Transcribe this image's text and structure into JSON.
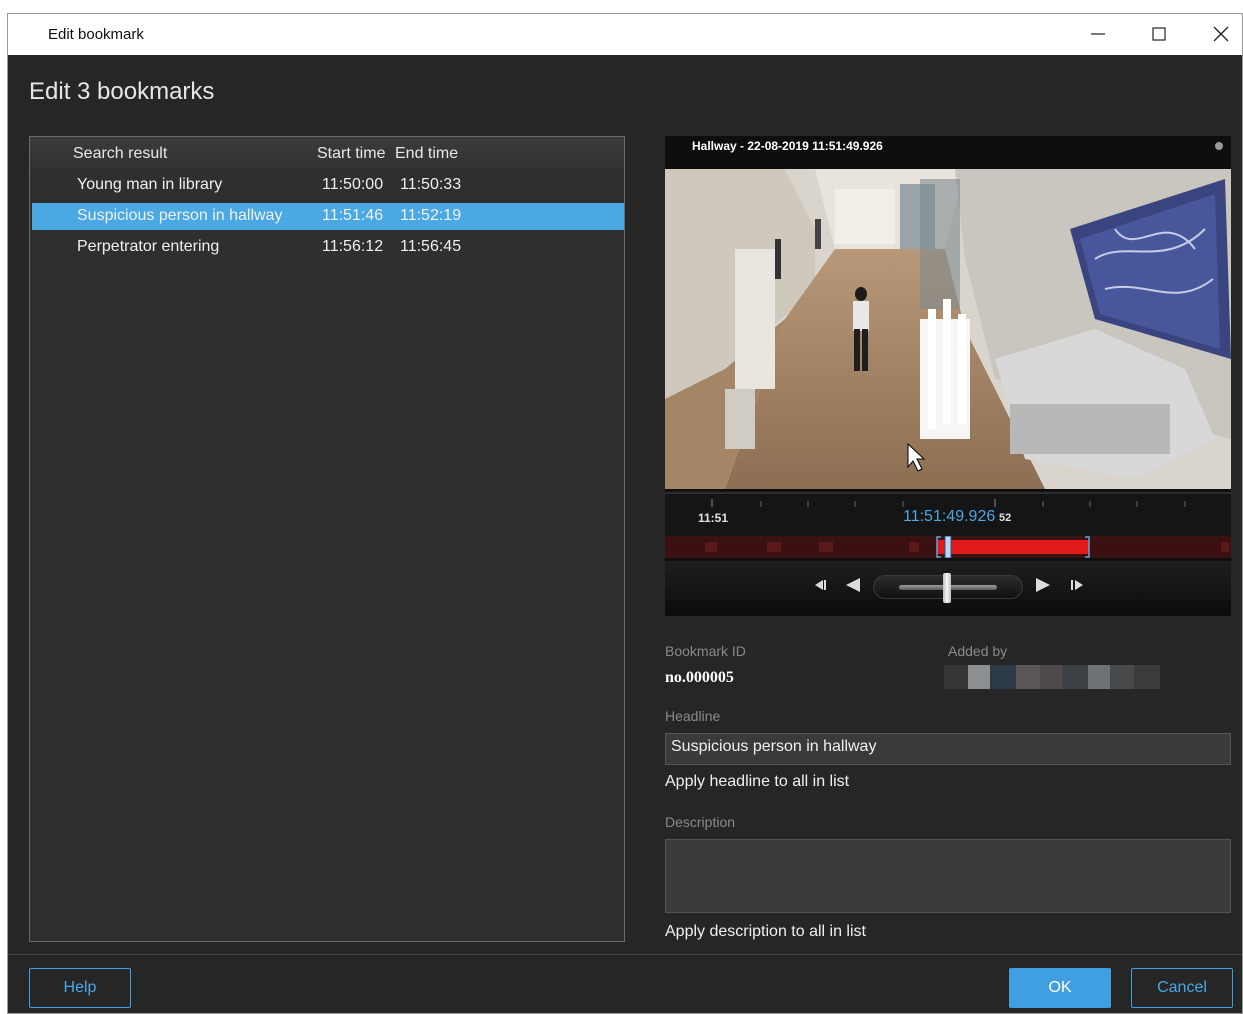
{
  "window": {
    "title": "Edit bookmark"
  },
  "page": {
    "title": "Edit 3 bookmarks"
  },
  "list": {
    "headers": [
      "Search result",
      "Start time",
      "End time"
    ],
    "rows": [
      {
        "name": "Young man in library",
        "start": "11:50:00",
        "end": "11:50:33",
        "selected": false
      },
      {
        "name": "Suspicious person in hallway",
        "start": "11:51:46",
        "end": "11:52:19",
        "selected": true
      },
      {
        "name": "Perpetrator entering",
        "start": "11:56:12",
        "end": "11:56:45",
        "selected": false
      }
    ]
  },
  "video": {
    "camera_label": "Hallway - 22-08-2019 11:51:49.926",
    "timeline": {
      "left_tick": "11:51",
      "current_time": "11:51:49.926",
      "right_tick_partial": "52"
    }
  },
  "details": {
    "bookmark_id_label": "Bookmark ID",
    "bookmark_id_value": "no.000005",
    "added_by_label": "Added by",
    "headline_label": "Headline",
    "headline_value": "Suspicious person in hallway",
    "apply_headline": "Apply headline to all in list",
    "description_label": "Description",
    "description_value": "",
    "apply_description": "Apply description to all in list"
  },
  "buttons": {
    "help": "Help",
    "ok": "OK",
    "cancel": "Cancel"
  },
  "colors": {
    "accent": "#3f9fe0",
    "selection": "#4aa8e2",
    "background": "#262626",
    "timeline_red": "#e01919"
  },
  "icons": [
    "minimize-icon",
    "maximize-icon",
    "close-icon",
    "step-back-icon",
    "play-reverse-icon",
    "play-icon",
    "step-forward-icon"
  ]
}
